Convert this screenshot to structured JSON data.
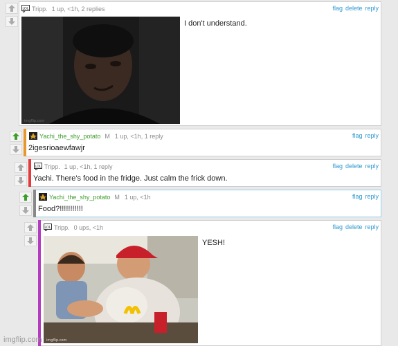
{
  "comments": [
    {
      "user": "Tripp.",
      "stats": "1 up, <1h, 2 replies",
      "actions": [
        "flag",
        "delete",
        "reply"
      ],
      "text": "I don't understand.",
      "image": "confused-man-meme",
      "bar_color": "#ffffff"
    },
    {
      "user": "Yachi_the_shy_potato",
      "mod": "M",
      "stats": "1 up, <1h, 1 reply",
      "actions": [
        "flag",
        "reply"
      ],
      "text": "2igesrioaewfawjr",
      "bar_color": "#e8982a"
    },
    {
      "user": "Tripp.",
      "stats": "1 up, <1h, 1 reply",
      "actions": [
        "flag",
        "delete",
        "reply"
      ],
      "text": "Yachi. There's food in the fridge. Just calm the frick down.",
      "bar_color": "#e53a3a"
    },
    {
      "user": "Yachi_the_shy_potato",
      "mod": "M",
      "stats": "1 up, <1h",
      "actions": [
        "flag",
        "reply"
      ],
      "text": "Food?!!!!!!!!!!!",
      "bar_color": "#888888"
    },
    {
      "user": "Tripp.",
      "stats": "0 ups, <1h",
      "actions": [
        "flag",
        "delete",
        "reply"
      ],
      "text": "YESH!",
      "image": "kids-fast-food-meme",
      "bar_color": "#b53bc0"
    }
  ],
  "watermark": "imgflip.com",
  "colors": {
    "link": "#2f98d0",
    "upvote": "#3f9d2c",
    "username_green": "#3f9d2c"
  }
}
